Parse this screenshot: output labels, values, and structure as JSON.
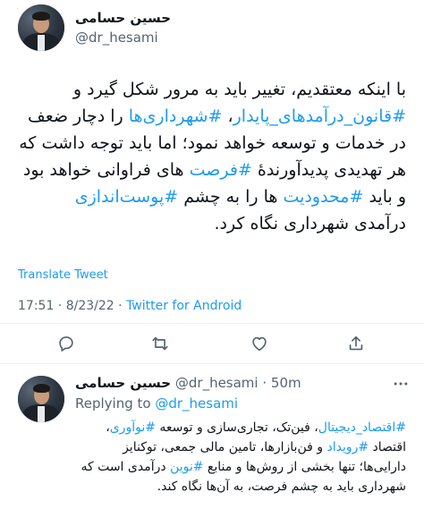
{
  "tweet": {
    "author_name": "حسین حسامی",
    "author_handle": "@dr_hesami",
    "body": {
      "t1": "با اینکه معتقدیم، تغییر باید به مرور شکل گیرد و ",
      "h1": "#قانون_درآمدهای_پایدار",
      "t2": "، ",
      "h2": "#شهرداری‌ها",
      "t3": " را دچار ضعف در خدمات و توسعه خواهد نمود؛ اما باید توجه داشت که هر تهدیدی پدیدآورندهٔ ",
      "h3": "#فرصت",
      "t4": " های فراوانی  خواهد بود و باید ",
      "h4": "#محدودیت",
      "t5": " ها را به چشم ",
      "h5": "#پوست‌اندازی",
      "t6": " درآمدی شهرداری نگاه کرد."
    },
    "translate_label": "Translate Tweet",
    "time": "17:51",
    "separator": " · ",
    "date": "8/23/22",
    "source": "Twitter for Android",
    "actions": {
      "reply_icon": "comment-icon",
      "retweet_icon": "retweet-icon",
      "like_icon": "heart-icon",
      "share_icon": "share-icon"
    }
  },
  "reply": {
    "author_name": "حسین حسامی",
    "author_handle": "@dr_hesami",
    "dot": " · ",
    "time": "50m",
    "more_icon": "more-icon",
    "replying_prefix": "Replying to ",
    "replying_handle": "@dr_hesami",
    "body": {
      "h1": "#اقتصاد_دیجیتال",
      "t1": "، فین‌تک، تجاری‌سازی و توسعه ",
      "h2": "#نوآوری",
      "t2": "، اقتصاد ",
      "h3": "#رویداد",
      "t3": " و فن‌بازارها، تامین مالی جمعی، توکنایز دارایی‌ها؛ تنها بخشی از روش‌ها و منابع ",
      "h4": "#نوین",
      "t4": " درآمدی است که شهرداری باید به چشم فرصت، به آن‌ها نگاه کند."
    }
  },
  "colors": {
    "link": "#1d9bf0",
    "text": "#0f1419",
    "muted": "#536471",
    "divider": "#eff3f4"
  }
}
